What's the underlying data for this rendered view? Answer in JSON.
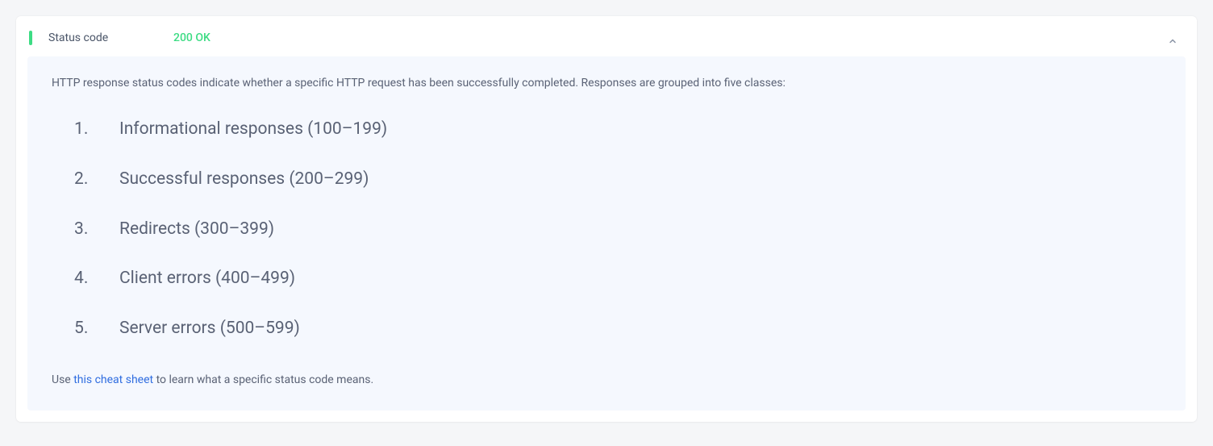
{
  "header": {
    "label": "Status code",
    "value": "200 OK"
  },
  "content": {
    "intro": "HTTP response status codes indicate whether a specific HTTP request has been successfully completed. Responses are grouped into five classes:",
    "classes": [
      "Informational responses (100–199)",
      "Successful responses (200–299)",
      "Redirects (300–399)",
      "Client errors (400–499)",
      "Server errors (500–599)"
    ],
    "footer_prefix": "Use ",
    "footer_link": "this cheat sheet",
    "footer_suffix": " to learn what a specific status code means."
  }
}
